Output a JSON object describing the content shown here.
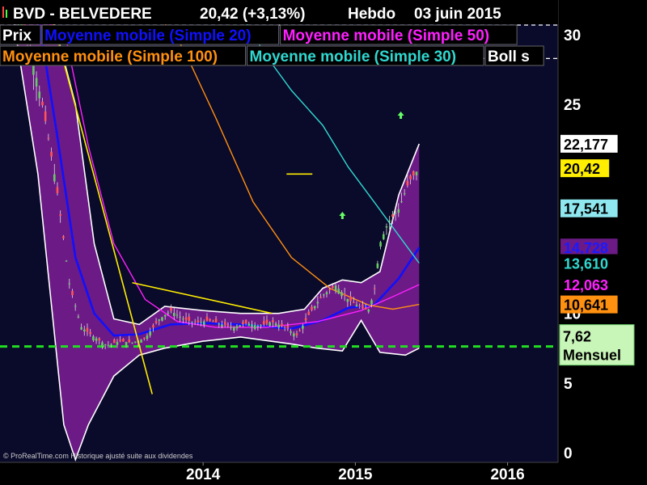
{
  "header": {
    "symbol": "BVD - BELVEDERE",
    "quote": "20,42 (+3,13%)",
    "period": "Hebdo",
    "date": "03 juin 2015"
  },
  "legend": {
    "row1": [
      {
        "label": "Prix",
        "color": "#ffffff"
      },
      {
        "label": "Moyenne mobile (Simple 20)",
        "color": "#1010ff"
      },
      {
        "label": "Moyenne mobile (Simple 50)",
        "color": "#ff20ff"
      }
    ],
    "row2": [
      {
        "label": "Moyenne mobile (Simple 100)",
        "color": "#ff9010"
      },
      {
        "label": "Moyenne mobile (Simple 30)",
        "color": "#30d8d0"
      },
      {
        "label": "Boll s",
        "color": "#ffffff"
      }
    ]
  },
  "copyright": "© ProRealTime.com Historique ajusté suite aux dividendes",
  "colors": {
    "background": "#0a0a2a",
    "axis_panel": "#000000",
    "band_fill": "#6b1a86",
    "band_edge": "#ffffff",
    "support": "#22dd22",
    "up_arrow": "#66ff66",
    "trendline": "#ffee00",
    "sma20": "#1010ff",
    "sma50": "#ff20ff",
    "sma100": "#ff9010",
    "sma30": "#30d8d0",
    "candle_up": "#66cc66",
    "candle_down": "#ff5555"
  },
  "chart_data": {
    "type": "line",
    "x_ticks": [
      "2014",
      "2015",
      "2016"
    ],
    "x_tick_dates": [
      "2014-01-01",
      "2015-01-01",
      "2016-01-01"
    ],
    "x_range": [
      "2012-09-01",
      "2016-05-01"
    ],
    "y_ticks": [
      0,
      5,
      10,
      25,
      30
    ],
    "y_range": [
      -0.7,
      32.5
    ],
    "grid": false,
    "price": [
      {
        "date": "2012-10-01",
        "value": 31.5
      },
      {
        "date": "2012-11-01",
        "value": 30.5
      },
      {
        "date": "2012-12-15",
        "value": 24.5
      },
      {
        "date": "2013-01-15",
        "value": 19.0
      },
      {
        "date": "2013-02-15",
        "value": 12.0
      },
      {
        "date": "2013-03-15",
        "value": 9.0
      },
      {
        "date": "2013-04-15",
        "value": 8.3
      },
      {
        "date": "2013-05-15",
        "value": 7.7
      },
      {
        "date": "2013-06-15",
        "value": 8.0
      },
      {
        "date": "2013-07-15",
        "value": 7.9
      },
      {
        "date": "2013-08-15",
        "value": 8.2
      },
      {
        "date": "2013-09-15",
        "value": 9.5
      },
      {
        "date": "2013-10-15",
        "value": 10.2
      },
      {
        "date": "2013-11-15",
        "value": 9.6
      },
      {
        "date": "2013-12-15",
        "value": 9.3
      },
      {
        "date": "2014-01-15",
        "value": 9.5
      },
      {
        "date": "2014-02-15",
        "value": 9.2
      },
      {
        "date": "2014-03-15",
        "value": 9.0
      },
      {
        "date": "2014-04-15",
        "value": 9.3
      },
      {
        "date": "2014-05-15",
        "value": 9.1
      },
      {
        "date": "2014-06-15",
        "value": 9.4
      },
      {
        "date": "2014-07-15",
        "value": 9.0
      },
      {
        "date": "2014-08-15",
        "value": 8.4
      },
      {
        "date": "2014-09-15",
        "value": 10.1
      },
      {
        "date": "2014-10-15",
        "value": 11.3
      },
      {
        "date": "2014-11-15",
        "value": 12.0
      },
      {
        "date": "2014-12-15",
        "value": 11.0
      },
      {
        "date": "2015-01-15",
        "value": 10.4
      },
      {
        "date": "2015-02-01",
        "value": 10.2
      },
      {
        "date": "2015-02-15",
        "value": 11.5
      },
      {
        "date": "2015-03-01",
        "value": 15.0
      },
      {
        "date": "2015-03-20",
        "value": 16.5
      },
      {
        "date": "2015-04-15",
        "value": 17.5
      },
      {
        "date": "2015-05-10",
        "value": 19.5
      },
      {
        "date": "2015-06-03",
        "value": 20.42
      }
    ],
    "bollinger_upper": [
      {
        "date": "2012-10-01",
        "value": 31.8
      },
      {
        "date": "2013-01-01",
        "value": 31.8
      },
      {
        "date": "2013-03-01",
        "value": 25.0
      },
      {
        "date": "2013-04-15",
        "value": 15.0
      },
      {
        "date": "2013-06-01",
        "value": 9.6
      },
      {
        "date": "2013-08-01",
        "value": 9.2
      },
      {
        "date": "2013-10-01",
        "value": 10.5
      },
      {
        "date": "2014-01-01",
        "value": 10.2
      },
      {
        "date": "2014-04-01",
        "value": 10.0
      },
      {
        "date": "2014-07-01",
        "value": 10.0
      },
      {
        "date": "2014-09-01",
        "value": 10.3
      },
      {
        "date": "2014-10-15",
        "value": 11.8
      },
      {
        "date": "2014-12-01",
        "value": 12.4
      },
      {
        "date": "2015-01-15",
        "value": 12.2
      },
      {
        "date": "2015-03-01",
        "value": 13.0
      },
      {
        "date": "2015-04-15",
        "value": 18.5
      },
      {
        "date": "2015-06-03",
        "value": 22.177
      }
    ],
    "bollinger_lower": [
      {
        "date": "2012-10-01",
        "value": 31.5
      },
      {
        "date": "2012-12-01",
        "value": 20.0
      },
      {
        "date": "2013-02-01",
        "value": 2.0
      },
      {
        "date": "2013-03-01",
        "value": -0.5
      },
      {
        "date": "2013-04-01",
        "value": 2.0
      },
      {
        "date": "2013-06-01",
        "value": 5.5
      },
      {
        "date": "2013-08-01",
        "value": 7.0
      },
      {
        "date": "2013-10-01",
        "value": 7.5
      },
      {
        "date": "2014-01-01",
        "value": 8.0
      },
      {
        "date": "2014-04-01",
        "value": 8.3
      },
      {
        "date": "2014-08-01",
        "value": 7.8
      },
      {
        "date": "2014-10-01",
        "value": 7.5
      },
      {
        "date": "2014-12-01",
        "value": 7.3
      },
      {
        "date": "2015-01-15",
        "value": 9.5
      },
      {
        "date": "2015-03-01",
        "value": 7.2
      },
      {
        "date": "2015-05-01",
        "value": 7.0
      },
      {
        "date": "2015-06-03",
        "value": 7.5
      }
    ],
    "series": [
      {
        "name": "Moyenne mobile (Simple 20)",
        "color": "#1010ff",
        "last": "14,728",
        "points": [
          {
            "date": "2012-12-01",
            "value": 31.5
          },
          {
            "date": "2013-01-15",
            "value": 23.0
          },
          {
            "date": "2013-03-01",
            "value": 14.0
          },
          {
            "date": "2013-04-15",
            "value": 10.0
          },
          {
            "date": "2013-06-01",
            "value": 8.4
          },
          {
            "date": "2013-08-01",
            "value": 8.5
          },
          {
            "date": "2013-10-15",
            "value": 9.2
          },
          {
            "date": "2014-01-01",
            "value": 9.3
          },
          {
            "date": "2014-04-01",
            "value": 9.2
          },
          {
            "date": "2014-08-01",
            "value": 8.9
          },
          {
            "date": "2014-10-15",
            "value": 9.5
          },
          {
            "date": "2014-12-15",
            "value": 10.4
          },
          {
            "date": "2015-02-15",
            "value": 10.6
          },
          {
            "date": "2015-04-15",
            "value": 12.5
          },
          {
            "date": "2015-06-03",
            "value": 14.728
          }
        ]
      },
      {
        "name": "Moyenne mobile (Simple 50)",
        "color": "#ff20ff",
        "last": "12,063",
        "points": [
          {
            "date": "2012-10-01",
            "value": 31.5
          },
          {
            "date": "2013-02-01",
            "value": 30.5
          },
          {
            "date": "2013-04-01",
            "value": 22.0
          },
          {
            "date": "2013-06-01",
            "value": 15.0
          },
          {
            "date": "2013-08-15",
            "value": 11.0
          },
          {
            "date": "2013-11-01",
            "value": 9.4
          },
          {
            "date": "2014-02-01",
            "value": 9.0
          },
          {
            "date": "2014-06-01",
            "value": 9.0
          },
          {
            "date": "2014-10-01",
            "value": 9.4
          },
          {
            "date": "2015-01-15",
            "value": 10.2
          },
          {
            "date": "2015-04-01",
            "value": 11.2
          },
          {
            "date": "2015-06-03",
            "value": 12.063
          }
        ]
      },
      {
        "name": "Moyenne mobile (Simple 100)",
        "color": "#ff9010",
        "last": "10,641",
        "points": [
          {
            "date": "2013-09-15",
            "value": 31.5
          },
          {
            "date": "2013-11-15",
            "value": 29.0
          },
          {
            "date": "2014-02-01",
            "value": 24.0
          },
          {
            "date": "2014-05-01",
            "value": 18.0
          },
          {
            "date": "2014-08-01",
            "value": 14.0
          },
          {
            "date": "2014-11-01",
            "value": 11.8
          },
          {
            "date": "2015-02-01",
            "value": 10.6
          },
          {
            "date": "2015-04-01",
            "value": 10.3
          },
          {
            "date": "2015-06-03",
            "value": 10.641
          }
        ]
      },
      {
        "name": "Moyenne mobile (Simple 30)",
        "color": "#30d8d0",
        "last": "13,610",
        "points": [
          {
            "date": "2014-04-01",
            "value": 31.5
          },
          {
            "date": "2014-06-01",
            "value": 28.5
          },
          {
            "date": "2014-08-01",
            "value": 26.0
          },
          {
            "date": "2014-10-15",
            "value": 23.5
          },
          {
            "date": "2014-12-15",
            "value": 20.5
          },
          {
            "date": "2015-02-15",
            "value": 18.0
          },
          {
            "date": "2015-04-15",
            "value": 15.6
          },
          {
            "date": "2015-06-03",
            "value": 13.61
          }
        ]
      }
    ],
    "horizontal_lines": [
      {
        "style": "dashed",
        "color": "#22dd22",
        "value": 7.62
      },
      {
        "style": "dashed",
        "color": "#ffffff",
        "value": 30.7
      },
      {
        "style": "dashed",
        "color": "#ffffff",
        "value": 28.3
      }
    ],
    "value_labels": [
      {
        "text": "22,177",
        "value": 22.177,
        "fg": "#000000",
        "bg": "#ffffff"
      },
      {
        "text": "20,42",
        "value": 20.42,
        "fg": "#000000",
        "bg": "#ffee00"
      },
      {
        "text": "17,541",
        "value": 17.541,
        "fg": "#000000",
        "bg": "#8fe8f0"
      },
      {
        "text": "14,728",
        "value": 14.728,
        "fg": "#1a1aff",
        "bg": "#6b1a86"
      },
      {
        "text": "13,610",
        "value": 13.61,
        "fg": "#30d8d0",
        "bg": "#000000"
      },
      {
        "text": "12,063",
        "value": 12.063,
        "fg": "#ff20ff",
        "bg": "#000000"
      },
      {
        "text": "10,641",
        "value": 10.641,
        "fg": "#000000",
        "bg": "#ff9010"
      }
    ],
    "support_label": {
      "value_text": "7,62",
      "period_text": "Mensuel"
    },
    "arrows": [
      {
        "date": "2014-12-01",
        "value": 17.0
      },
      {
        "date": "2015-04-20",
        "value": 24.2
      },
      {
        "date": "2015-05-25",
        "value": 29.5
      }
    ],
    "yellow_lines": [
      {
        "from": {
          "date": "2013-01-01",
          "value": 31.5
        },
        "to": {
          "date": "2013-09-01",
          "value": 4.2
        }
      },
      {
        "from": {
          "date": "2013-07-15",
          "value": 12.2
        },
        "to": {
          "date": "2014-06-15",
          "value": 10.0
        }
      },
      {
        "from": {
          "date": "2014-07-20",
          "value": 20.0
        },
        "to": {
          "date": "2014-09-20",
          "value": 20.0
        }
      }
    ]
  }
}
